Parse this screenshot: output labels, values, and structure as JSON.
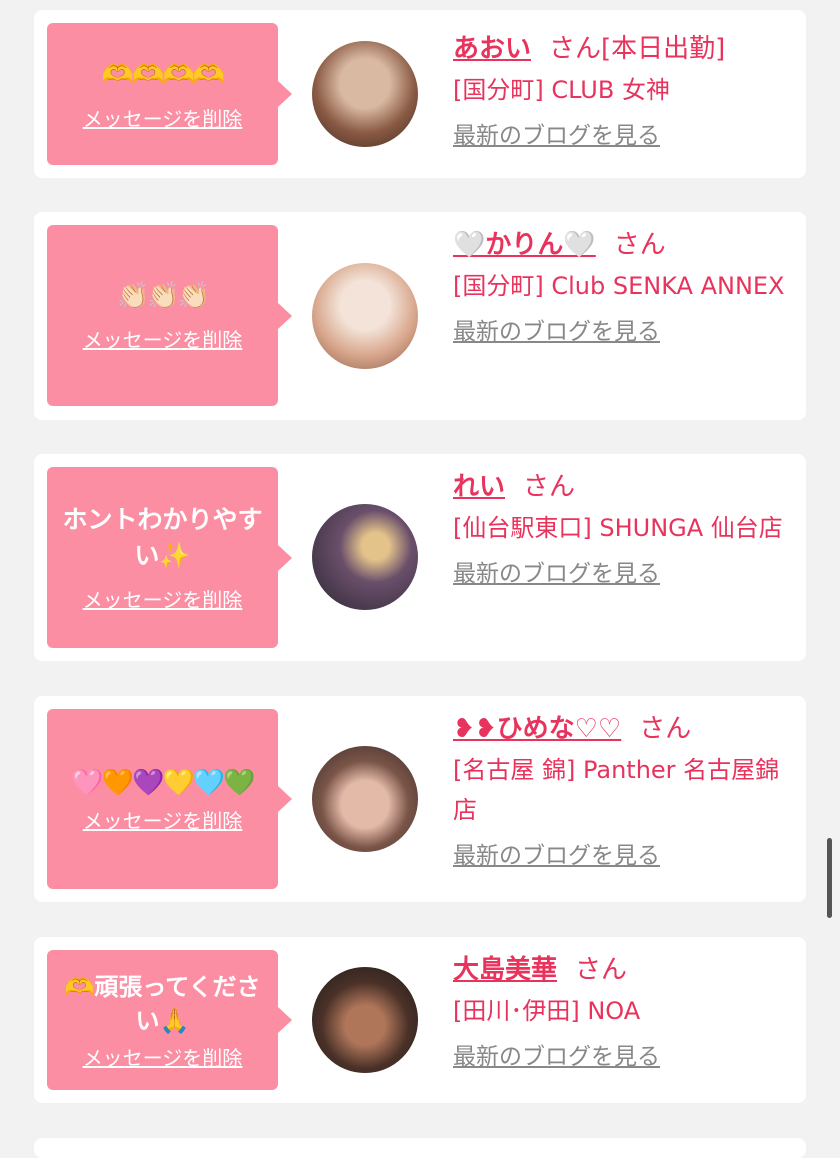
{
  "delete_label": "メッセージを削除",
  "san_label": "さん",
  "blog_label": "最新のブログを見る",
  "colors": {
    "accent": "#e8335d",
    "bubble": "#fc8ea3",
    "link_gray": "#888888"
  },
  "cards": [
    {
      "message": "🫶🫶🫶🫶",
      "name": "あおい",
      "suffix": "[本日出勤]",
      "shop": "[国分町] CLUB 女神",
      "avatar_colors": [
        "#8a5a44",
        "#d9b9a2"
      ]
    },
    {
      "message": "👏🏻👏🏻👏🏻",
      "name": "🤍かりん🤍",
      "suffix": "",
      "shop": "[国分町] Club SENKA ANNEX",
      "avatar_colors": [
        "#e6c8b4",
        "#f3e3d8"
      ]
    },
    {
      "message": "ホントわかりやすい✨",
      "name": "れい",
      "suffix": "",
      "shop": "[仙台駅東口] SHUNGA 仙台店",
      "avatar_colors": [
        "#2a2630",
        "#6a4f6b"
      ]
    },
    {
      "message": "🩷🧡💜💛🩵💚",
      "name": "❥❥ひめな♡♡",
      "suffix": "",
      "shop": "[名古屋 錦] Panther 名古屋錦店",
      "avatar_colors": [
        "#3b2c2a",
        "#e3b9a8"
      ]
    },
    {
      "message": "🫶頑張ってください🙏",
      "name": "大島美華",
      "suffix": "",
      "shop": "[田川･伊田] NOA",
      "avatar_colors": [
        "#1d1a18",
        "#b0765a"
      ]
    }
  ]
}
